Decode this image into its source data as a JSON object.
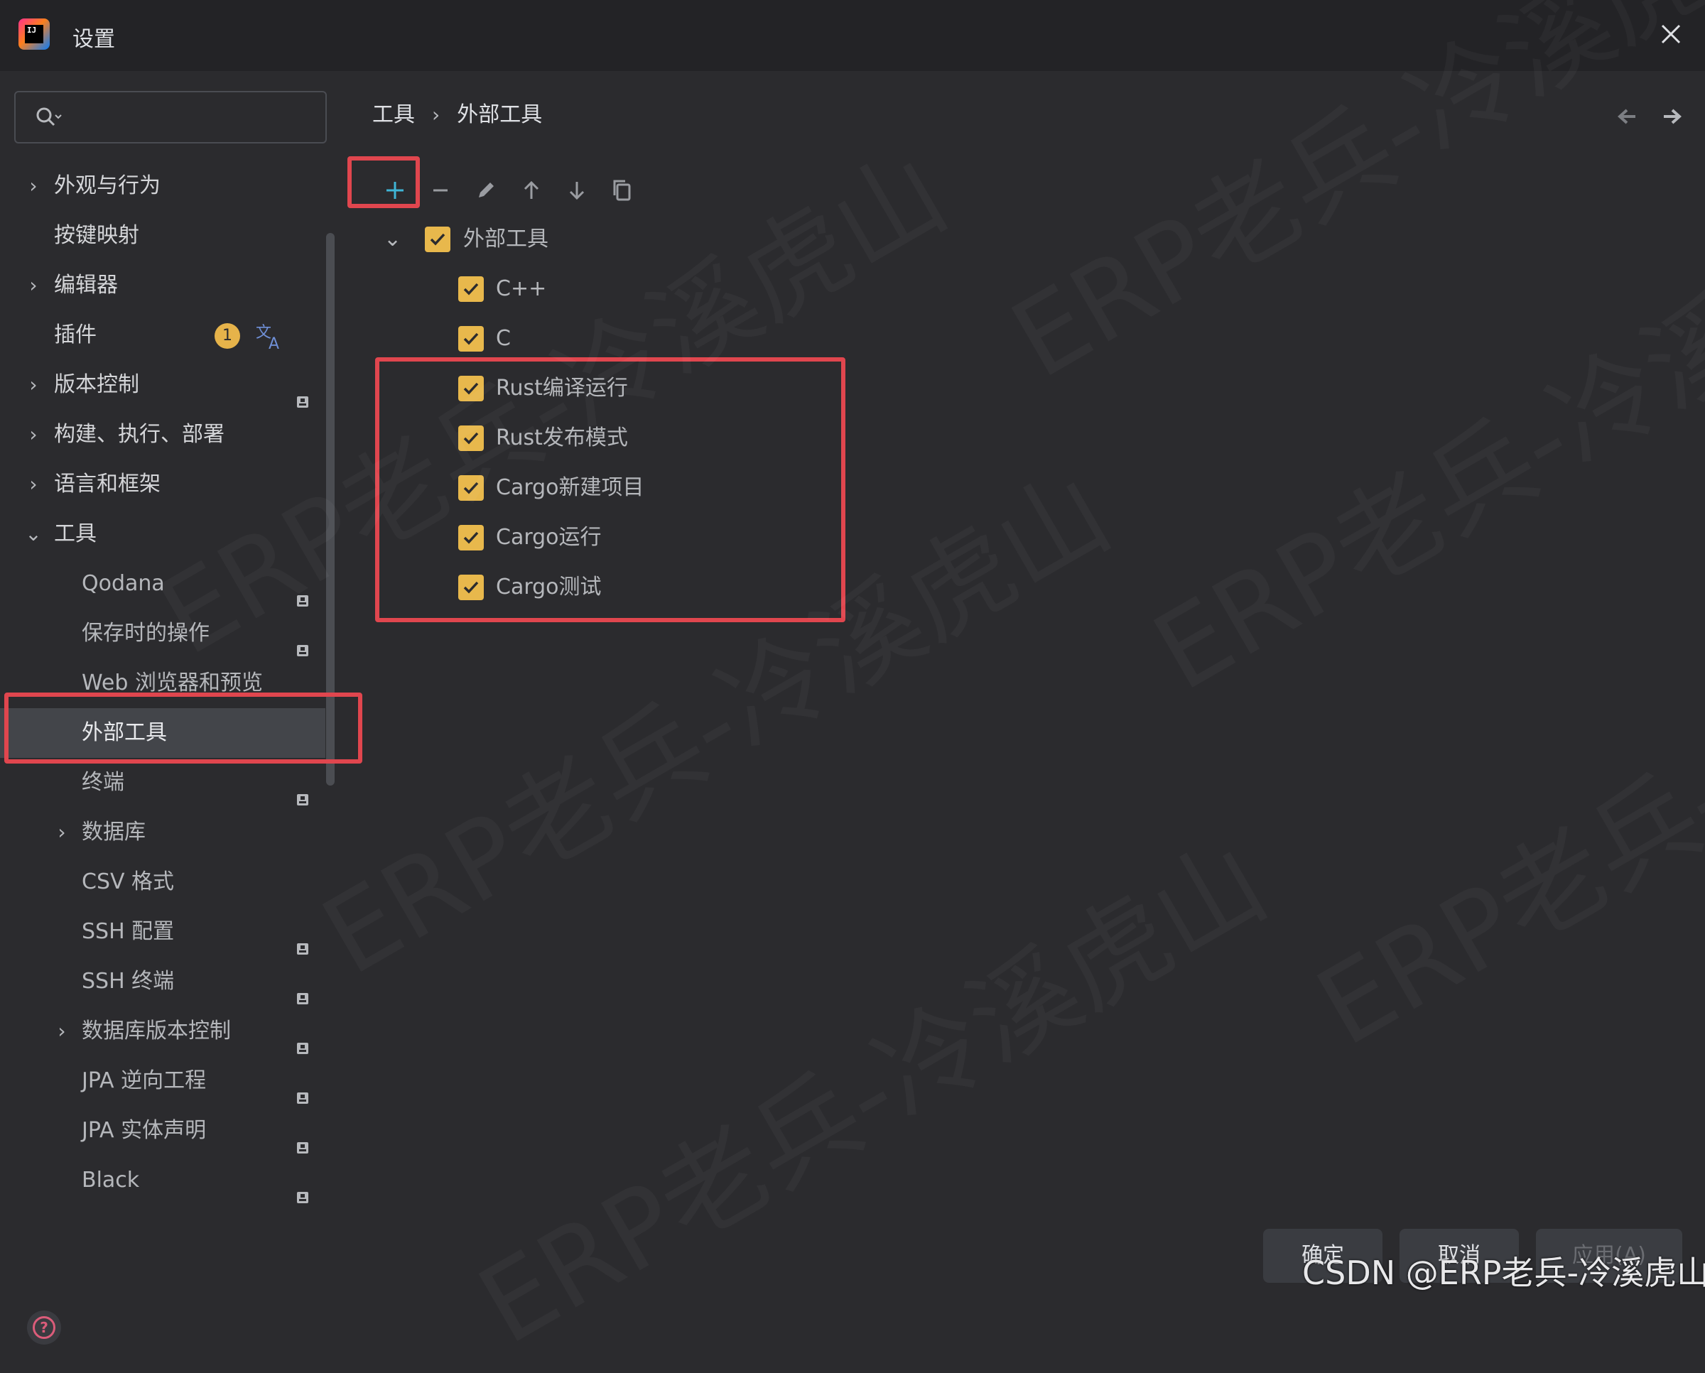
{
  "window": {
    "title": "设置",
    "close_icon": "close-icon"
  },
  "sidebar": {
    "search": {
      "value": "",
      "placeholder": ""
    },
    "items": [
      {
        "label": "外观与行为",
        "expandable": true,
        "expanded": false
      },
      {
        "label": "按键映射",
        "expandable": false
      },
      {
        "label": "编辑器",
        "expandable": true,
        "expanded": false
      },
      {
        "label": "插件",
        "expandable": false,
        "badge": "1"
      },
      {
        "label": "版本控制",
        "expandable": true,
        "expanded": false
      },
      {
        "label": "构建、执行、部署",
        "expandable": true,
        "expanded": false
      },
      {
        "label": "语言和框架",
        "expandable": true,
        "expanded": false
      },
      {
        "label": "工具",
        "expandable": true,
        "expanded": true
      },
      {
        "label": "Qodana"
      },
      {
        "label": "保存时的操作"
      },
      {
        "label": "Web 浏览器和预览"
      },
      {
        "label": "外部工具",
        "selected": true
      },
      {
        "label": "终端"
      },
      {
        "label": "数据库",
        "expandable": true,
        "expanded": false
      },
      {
        "label": "CSV 格式"
      },
      {
        "label": "SSH 配置"
      },
      {
        "label": "SSH 终端"
      },
      {
        "label": "数据库版本控制",
        "expandable": true,
        "expanded": false
      },
      {
        "label": "JPA 逆向工程"
      },
      {
        "label": "JPA 实体声明"
      },
      {
        "label": "Black"
      }
    ]
  },
  "main": {
    "breadcrumb": [
      "工具",
      "外部工具"
    ],
    "toolbar": [
      "add-icon",
      "remove-icon",
      "edit-icon",
      "move-up-icon",
      "move-down-icon",
      "copy-icon"
    ],
    "group": {
      "label": "外部工具",
      "checked": true,
      "expanded": true
    },
    "tools": [
      {
        "label": "C++",
        "checked": true
      },
      {
        "label": "C",
        "checked": true
      },
      {
        "label": "Rust编译运行",
        "checked": true
      },
      {
        "label": "Rust发布模式",
        "checked": true
      },
      {
        "label": "Cargo新建项目",
        "checked": true
      },
      {
        "label": "Cargo运行",
        "checked": true
      },
      {
        "label": "Cargo测试",
        "checked": true
      }
    ]
  },
  "footer": {
    "ok": "确定",
    "cancel": "取消",
    "apply": "应用(A)"
  },
  "watermark": "ERP老兵-冷溪虎山",
  "credit": "CSDN @ERP老兵-冷溪虎山",
  "colors": {
    "accent_checkbox": "#e8b84c",
    "highlight_box": "#e0464e",
    "selected_row": "#43454a",
    "add_icon": "#3fb5d6"
  }
}
